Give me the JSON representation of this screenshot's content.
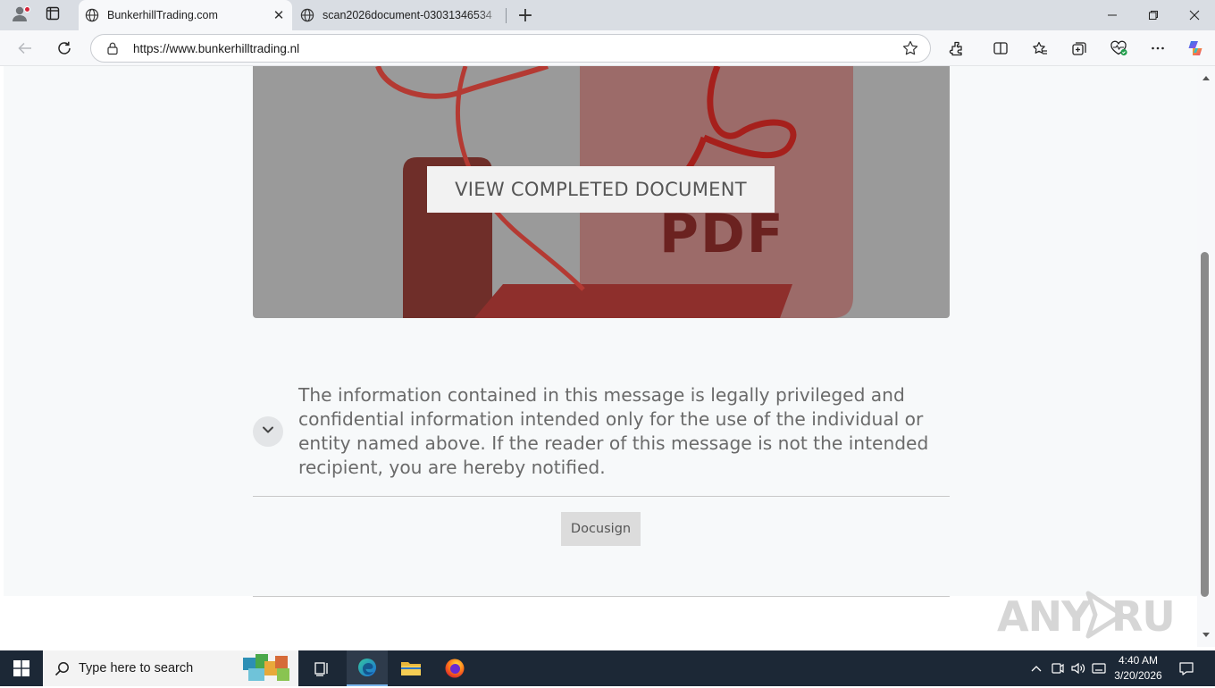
{
  "browser": {
    "tabs": [
      {
        "title": "BunkerhillTrading.com",
        "active": true
      },
      {
        "title": "scan2026document-03031346534",
        "active": false
      }
    ],
    "address": {
      "url": "https://www.bunkerhilltrading.nl"
    }
  },
  "page": {
    "hero": {
      "pdf_label": "PDF",
      "view_button": "VIEW COMPLETED DOCUMENT"
    },
    "disclaimer": "The information contained in this message is legally privileged and confidential information intended only for the use of the individual or entity named above. If the reader of this message is not the intended recipient, you are hereby notified.",
    "footer_button": "Docusign",
    "watermark": "ANY RUN"
  },
  "taskbar": {
    "search_placeholder": "Type here to search",
    "clock": {
      "time": "4:40 AM",
      "date": "3/20/2026"
    }
  },
  "colors": {
    "hero_bg": "#9a9a9a",
    "pdf_red": "#c0312b",
    "taskbar": "#1c2836"
  }
}
